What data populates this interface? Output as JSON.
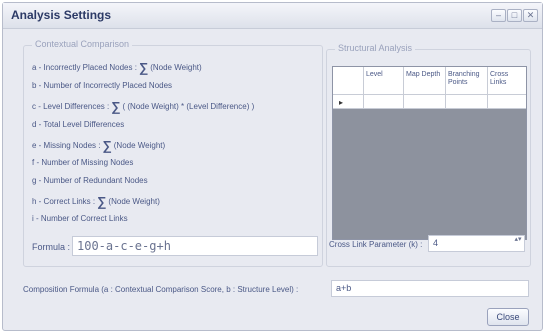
{
  "window": {
    "title": "Analysis Settings",
    "controls": {
      "minimize": "–",
      "maximize": "□",
      "close": "✕"
    }
  },
  "left_group": {
    "legend": "Contextual Comparison",
    "rules": [
      {
        "prefix": "a - Incorrectly Placed Nodes :",
        "sigma": "∑",
        "suffix": "(Node Weight)"
      },
      {
        "prefix": "b - Number of Incorrectly Placed Nodes",
        "sigma": "",
        "suffix": ""
      },
      {
        "prefix": "c - Level Differences :",
        "sigma": "∑",
        "suffix": "( (Node Weight) * (Level Difference) )"
      },
      {
        "prefix": "d - Total Level Differences",
        "sigma": "",
        "suffix": ""
      },
      {
        "prefix": "e - Missing Nodes :",
        "sigma": "∑",
        "suffix": "(Node Weight)"
      },
      {
        "prefix": "f - Number of Missing Nodes",
        "sigma": "",
        "suffix": ""
      },
      {
        "prefix": "g - Number of Redundant Nodes",
        "sigma": "",
        "suffix": ""
      },
      {
        "prefix": "h - Correct Links :",
        "sigma": "∑",
        "suffix": "(Node Weight)"
      },
      {
        "prefix": "i - Number of Correct Links",
        "sigma": "",
        "suffix": ""
      }
    ],
    "formula_label": "Formula :",
    "formula_value": "100-a-c-e-g+h"
  },
  "right_group": {
    "legend": "Structural Analysis",
    "columns": [
      "Level",
      "Map Depth",
      "Branching Points",
      "Cross Links"
    ],
    "row_marker": "▸",
    "cross_link_label": "Cross Link Parameter (k) :",
    "cross_link_value": "4",
    "spinner": "▴▾"
  },
  "composition": {
    "label": "Composition Formula (a : Contextual Comparison Score, b : Structure Level) :",
    "value": "a+b"
  },
  "close_button": "Close"
}
